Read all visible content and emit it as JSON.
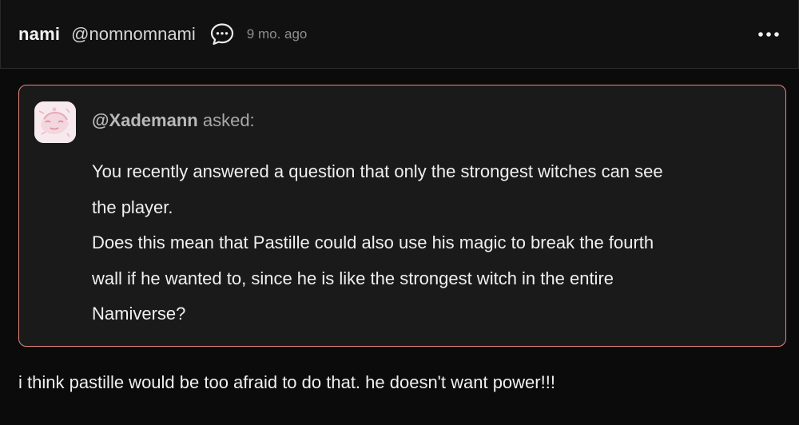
{
  "post": {
    "author_name": "nami",
    "author_handle": "@nomnomnami",
    "timestamp": "9 mo. ago",
    "icons": {
      "message": "speech-bubble-ellipsis-icon",
      "more": "more-horizontal-icon",
      "avatar": "asker-avatar"
    }
  },
  "ask": {
    "asker_handle": "@Xademann",
    "asked_label": "asked:",
    "border_color": "#e8867f",
    "body_lines": [
      "You recently answered a question that only the strongest witches can see",
      "the player.",
      "Does this mean that Pastille could also use his magic to break the fourth",
      "wall if he wanted to, since he is like the strongest witch in the entire",
      "Namiverse?"
    ]
  },
  "answer": {
    "text": "i think pastille would be too afraid to do that. he doesn't want power!!!"
  }
}
